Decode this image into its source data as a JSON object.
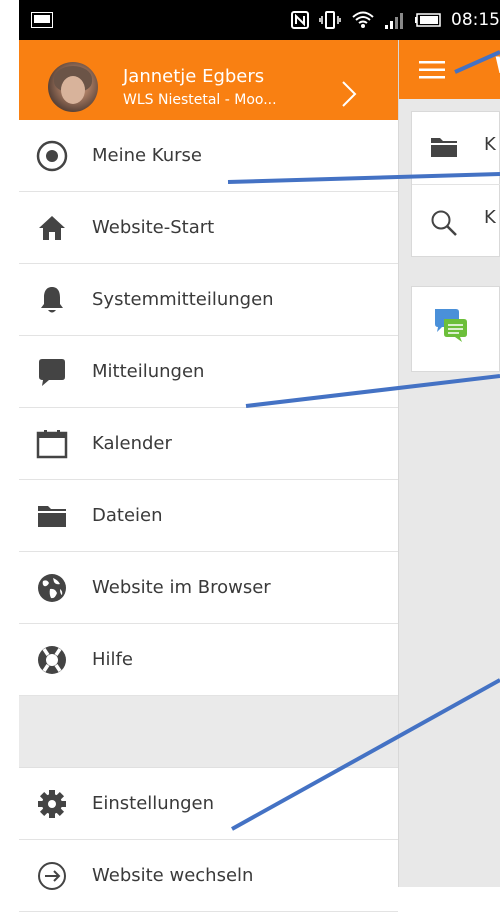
{
  "status_bar": {
    "time": "08:15"
  },
  "drawer": {
    "user": {
      "name": "Jannetje Egbers",
      "site": "WLS Niestetal - Moo..."
    },
    "menu_items": [
      {
        "label": "Meine Kurse",
        "icon": "target-circle-icon"
      },
      {
        "label": "Website-Start",
        "icon": "home-icon"
      },
      {
        "label": "Systemmitteilungen",
        "icon": "bell-icon"
      },
      {
        "label": "Mitteilungen",
        "icon": "chat-bubble-icon"
      },
      {
        "label": "Kalender",
        "icon": "calendar-icon"
      },
      {
        "label": "Dateien",
        "icon": "folder-icon"
      },
      {
        "label": "Website im Browser",
        "icon": "globe-icon"
      },
      {
        "label": "Hilfe",
        "icon": "lifebuoy-icon"
      }
    ],
    "bottom_items": [
      {
        "label": "Einstellungen",
        "icon": "gear-icon"
      },
      {
        "label": "Website wechseln",
        "icon": "switch-arrow-icon"
      }
    ]
  },
  "content": {
    "toolbar_letter": "W",
    "card_rows": [
      {
        "text": "K",
        "icon": "folder-icon"
      },
      {
        "text": "K",
        "icon": "search-icon"
      }
    ]
  },
  "colors": {
    "accent": "#f98012",
    "annotation": "#4472c4"
  }
}
